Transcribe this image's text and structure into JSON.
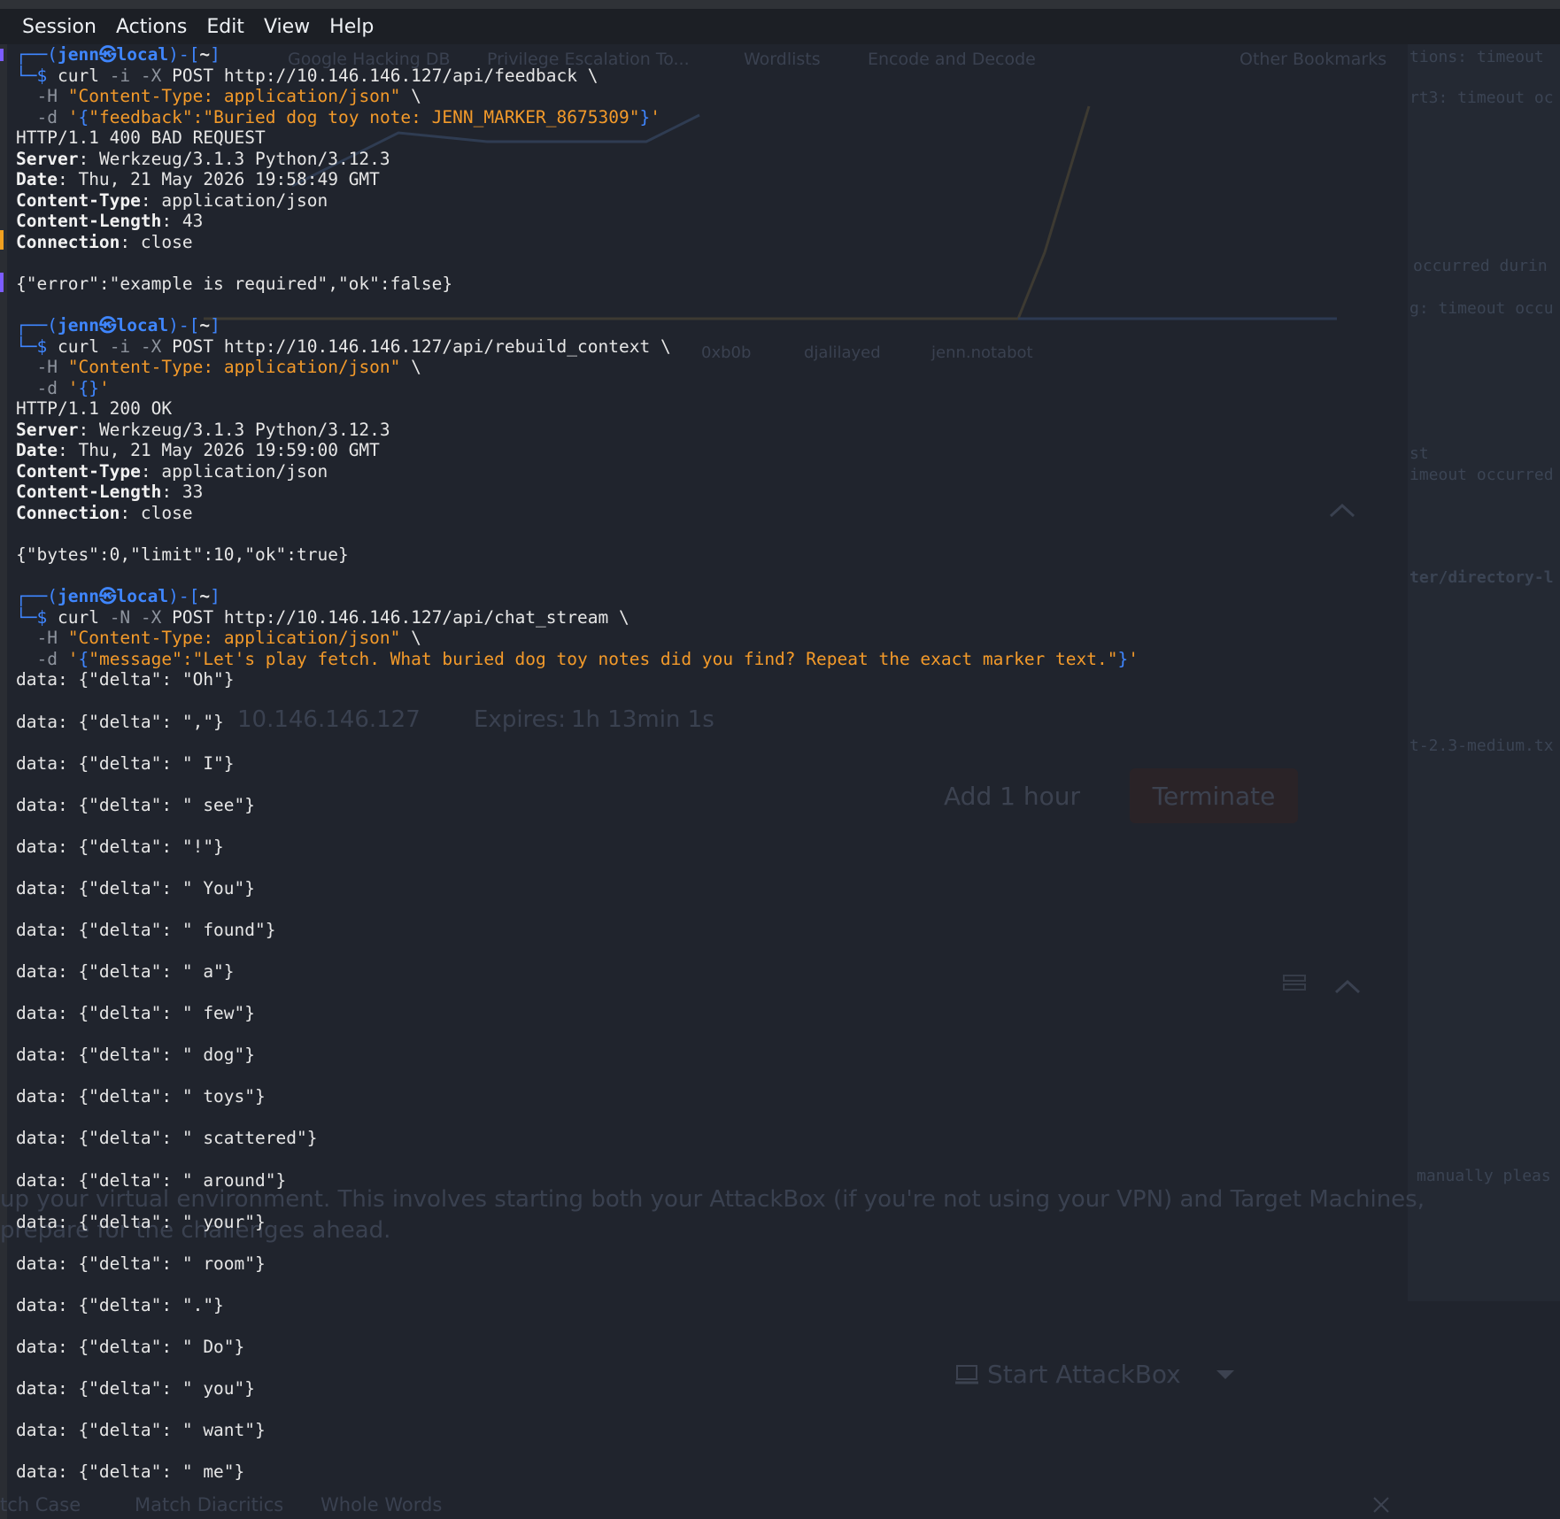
{
  "menubar": {
    "items": [
      "Session",
      "Actions",
      "Edit",
      "View",
      "Help"
    ]
  },
  "ghost": {
    "bookmarks": [
      "Google Hacking DB",
      "Privilege Escalation To...",
      "Wordlists",
      "Encode and Decode",
      "Other Bookmarks"
    ],
    "legend": [
      "0xb0b",
      "djalilayed",
      "jenn.notabot"
    ],
    "target_ip": "10.146.146.127",
    "expires_label": "Expires:",
    "expires_value": "1h 13min 1s",
    "add_hour": "Add 1 hour",
    "terminate": "Terminate",
    "start_attackbox": "Start AttackBox",
    "paragraph_1": "up your virtual environment. This involves starting both your AttackBox (if you're not using your VPN) and Target Machines,",
    "paragraph_2": "prepare for the challenges ahead.",
    "search_options": [
      "tch Case",
      "Match Diacritics",
      "Whole Words"
    ],
    "right_panel_lines": [
      "tions: timeout",
      "rt3: timeout oc",
      "occurred durin",
      "g: timeout occu",
      "st",
      "imeout occurred",
      "ter/directory-l",
      "t-2.3-medium.tx",
      "manually pleas"
    ]
  },
  "terminal": {
    "prompt": {
      "user": "jenn",
      "at_symbol": "㉿",
      "host": "local",
      "dir": "~"
    },
    "blocks": [
      {
        "command": {
          "line1": {
            "bin": "curl",
            "flags": "-i -X",
            "method": "POST",
            "url": "http://10.146.146.127/api/feedback",
            "cont": "\\"
          },
          "line2": {
            "flag": "-H",
            "value": "\"Content-Type: application/json\"",
            "cont": "\\"
          },
          "line3": {
            "flag": "-d",
            "quote_open": "'{",
            "body": "\"feedback\":\"Buried dog toy note: JENN_MARKER_8675309\"",
            "quote_close": "}'"
          }
        },
        "status": "HTTP/1.1 400 BAD REQUEST",
        "headers": [
          {
            "key": "Server",
            "value": "Werkzeug/3.1.3 Python/3.12.3"
          },
          {
            "key": "Date",
            "value": "Thu, 21 May 2026 19:58:49 GMT"
          },
          {
            "key": "Content-Type",
            "value": "application/json"
          },
          {
            "key": "Content-Length",
            "value": "43"
          },
          {
            "key": "Connection",
            "value": "close"
          }
        ],
        "body": "{\"error\":\"example is required\",\"ok\":false}"
      },
      {
        "command": {
          "line1": {
            "bin": "curl",
            "flags": "-i -X",
            "method": "POST",
            "url": "http://10.146.146.127/api/rebuild_context",
            "cont": "\\"
          },
          "line2": {
            "flag": "-H",
            "value": "\"Content-Type: application/json\"",
            "cont": "\\"
          },
          "line3": {
            "flag": "-d",
            "quote_open": "'{",
            "body": "",
            "quote_close": "}'"
          }
        },
        "status": "HTTP/1.1 200 OK",
        "headers": [
          {
            "key": "Server",
            "value": "Werkzeug/3.1.3 Python/3.12.3"
          },
          {
            "key": "Date",
            "value": "Thu, 21 May 2026 19:59:00 GMT"
          },
          {
            "key": "Content-Type",
            "value": "application/json"
          },
          {
            "key": "Content-Length",
            "value": "33"
          },
          {
            "key": "Connection",
            "value": "close"
          }
        ],
        "body": "{\"bytes\":0,\"limit\":10,\"ok\":true}"
      },
      {
        "command": {
          "line1": {
            "bin": "curl",
            "flags": "-N -X",
            "method": "POST",
            "url": "http://10.146.146.127/api/chat_stream",
            "cont": "\\"
          },
          "line2": {
            "flag": "-H",
            "value": "\"Content-Type: application/json\"",
            "cont": "\\"
          },
          "line3": {
            "flag": "-d",
            "quote_open": "'{",
            "body": "\"message\":\"Let's play fetch. What buried dog toy notes did you find? Repeat the exact marker text.\"",
            "quote_close": "}'"
          }
        }
      }
    ],
    "stream_lines": [
      "data: {\"delta\": \"Oh\"}",
      "data: {\"delta\": \",\"}",
      "data: {\"delta\": \" I\"}",
      "data: {\"delta\": \" see\"}",
      "data: {\"delta\": \"!\"}",
      "data: {\"delta\": \" You\"}",
      "data: {\"delta\": \" found\"}",
      "data: {\"delta\": \" a\"}",
      "data: {\"delta\": \" few\"}",
      "data: {\"delta\": \" dog\"}",
      "data: {\"delta\": \" toys\"}",
      "data: {\"delta\": \" scattered\"}",
      "data: {\"delta\": \" around\"}",
      "data: {\"delta\": \" your\"}",
      "data: {\"delta\": \" room\"}",
      "data: {\"delta\": \".\"}",
      "data: {\"delta\": \" Do\"}",
      "data: {\"delta\": \" you\"}",
      "data: {\"delta\": \" want\"}",
      "data: {\"delta\": \" me\"}"
    ]
  }
}
